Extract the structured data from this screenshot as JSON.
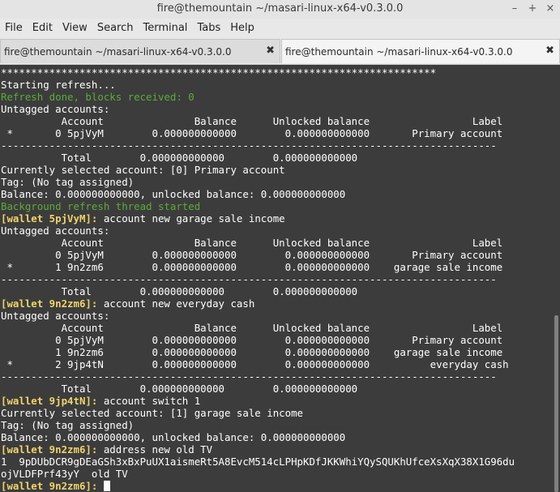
{
  "window": {
    "title": "fire@themountain ~/masari-linux-x64-v0.3.0.0"
  },
  "menu": [
    "File",
    "Edit",
    "View",
    "Search",
    "Terminal",
    "Tabs",
    "Help"
  ],
  "tabs": [
    {
      "label": "fire@themountain ~/masari-linux-x64-v0.3.0.0",
      "close": "✖",
      "active": false
    },
    {
      "label": "fire@themountain ~/masari-linux-x64-v0.3.0.0",
      "close": "✖",
      "active": true
    }
  ],
  "terminal": {
    "lines": [
      {
        "segs": [
          {
            "t": "************************************************************************"
          }
        ]
      },
      {
        "segs": [
          {
            "t": "Starting refresh..."
          }
        ]
      },
      {
        "segs": [
          {
            "t": "Refresh done, blocks received: 0",
            "c": "g"
          }
        ]
      },
      {
        "segs": [
          {
            "t": "Untagged accounts:"
          }
        ]
      },
      {
        "segs": [
          {
            "t": "          Account               Balance      Unlocked balance                 Label"
          }
        ]
      },
      {
        "segs": [
          {
            "t": " *       0 5pjVyM        0.000000000000        0.000000000000       Primary account"
          }
        ]
      },
      {
        "segs": [
          {
            "t": "----------------------------------------------------------------------------------"
          }
        ]
      },
      {
        "segs": [
          {
            "t": "          Total        0.000000000000        0.000000000000"
          }
        ]
      },
      {
        "segs": [
          {
            "t": "Currently selected account: [0] Primary account"
          }
        ]
      },
      {
        "segs": [
          {
            "t": "Tag: (No tag assigned)"
          }
        ]
      },
      {
        "segs": [
          {
            "t": "Balance: 0.000000000000, unlocked balance: 0.000000000000"
          }
        ]
      },
      {
        "segs": [
          {
            "t": "Background refresh thread started",
            "c": "g"
          }
        ]
      },
      {
        "segs": [
          {
            "t": "[wallet 5pjVyM]:",
            "c": "y"
          },
          {
            "t": " account new garage sale income"
          }
        ]
      },
      {
        "segs": [
          {
            "t": "Untagged accounts:"
          }
        ]
      },
      {
        "segs": [
          {
            "t": "          Account               Balance      Unlocked balance                 Label"
          }
        ]
      },
      {
        "segs": [
          {
            "t": "         0 5pjVyM        0.000000000000        0.000000000000       Primary account"
          }
        ]
      },
      {
        "segs": [
          {
            "t": " *       1 9n2zm6        0.000000000000        0.000000000000    garage sale income"
          }
        ]
      },
      {
        "segs": [
          {
            "t": "----------------------------------------------------------------------------------"
          }
        ]
      },
      {
        "segs": [
          {
            "t": "          Total        0.000000000000        0.000000000000"
          }
        ]
      },
      {
        "segs": [
          {
            "t": "[wallet 9n2zm6]:",
            "c": "y"
          },
          {
            "t": " account new everyday cash"
          }
        ]
      },
      {
        "segs": [
          {
            "t": "Untagged accounts:"
          }
        ]
      },
      {
        "segs": [
          {
            "t": "          Account               Balance      Unlocked balance                 Label"
          }
        ]
      },
      {
        "segs": [
          {
            "t": "         0 5pjVyM        0.000000000000        0.000000000000       Primary account"
          }
        ]
      },
      {
        "segs": [
          {
            "t": "         1 9n2zm6        0.000000000000        0.000000000000    garage sale income"
          }
        ]
      },
      {
        "segs": [
          {
            "t": " *       2 9jp4tN        0.000000000000        0.000000000000          everyday cash"
          }
        ]
      },
      {
        "segs": [
          {
            "t": "----------------------------------------------------------------------------------"
          }
        ]
      },
      {
        "segs": [
          {
            "t": "          Total        0.000000000000        0.000000000000"
          }
        ]
      },
      {
        "segs": [
          {
            "t": "[wallet 9jp4tN]:",
            "c": "y"
          },
          {
            "t": " account switch 1"
          }
        ]
      },
      {
        "segs": [
          {
            "t": "Currently selected account: [1] garage sale income"
          }
        ]
      },
      {
        "segs": [
          {
            "t": "Tag: (No tag assigned)"
          }
        ]
      },
      {
        "segs": [
          {
            "t": "Balance: 0.000000000000, unlocked balance: 0.000000000000"
          }
        ]
      },
      {
        "segs": [
          {
            "t": "[wallet 9n2zm6]:",
            "c": "y"
          },
          {
            "t": " address new old TV"
          }
        ]
      },
      {
        "segs": [
          {
            "t": "1  9pDUbDCR9gDEaGSh3xBxPuUX1aismeRt5A8EvcM514cLPHpKDfJKKWhiYQySQUKhUfceXsXqX38X1G96du"
          }
        ]
      },
      {
        "segs": [
          {
            "t": "ojVLDFPrf43yY  old TV"
          }
        ]
      },
      {
        "segs": [
          {
            "t": "[wallet 9n2zm6]:",
            "c": "y"
          },
          {
            "t": " "
          }
        ],
        "cursor": true
      }
    ]
  },
  "colors": {
    "background": "#3c3c3c",
    "text": "#ffffff",
    "green": "#5dab3a",
    "prompt": "#f0d36b"
  }
}
